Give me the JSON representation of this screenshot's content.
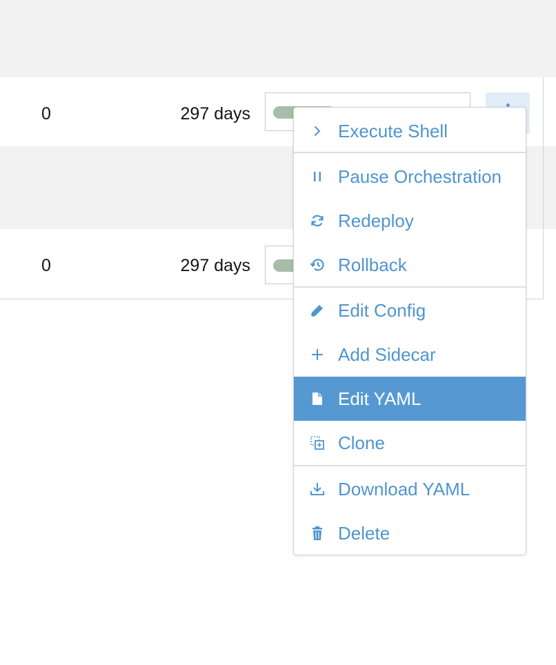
{
  "table": {
    "rows": [
      {
        "restarts": "0",
        "age": "297 days"
      },
      {
        "restarts": "0",
        "age": "297 days"
      }
    ]
  },
  "menu": {
    "items": [
      {
        "label": "Execute Shell",
        "icon": "chevron-right-icon"
      },
      {
        "label": "Pause Orchestration",
        "icon": "pause-icon"
      },
      {
        "label": "Redeploy",
        "icon": "refresh-icon"
      },
      {
        "label": "Rollback",
        "icon": "history-icon"
      },
      {
        "label": "Edit Config",
        "icon": "pencil-icon"
      },
      {
        "label": "Add Sidecar",
        "icon": "plus-icon"
      },
      {
        "label": "Edit YAML",
        "icon": "file-icon",
        "active": true
      },
      {
        "label": "Clone",
        "icon": "copy-icon"
      },
      {
        "label": "Download YAML",
        "icon": "download-icon"
      },
      {
        "label": "Delete",
        "icon": "trash-icon"
      }
    ]
  },
  "colors": {
    "accent": "#4f95cf",
    "active_bg": "#5699d2",
    "scale_bar": "#a7bda8",
    "row_alt_bg": "#f2f2f2"
  }
}
